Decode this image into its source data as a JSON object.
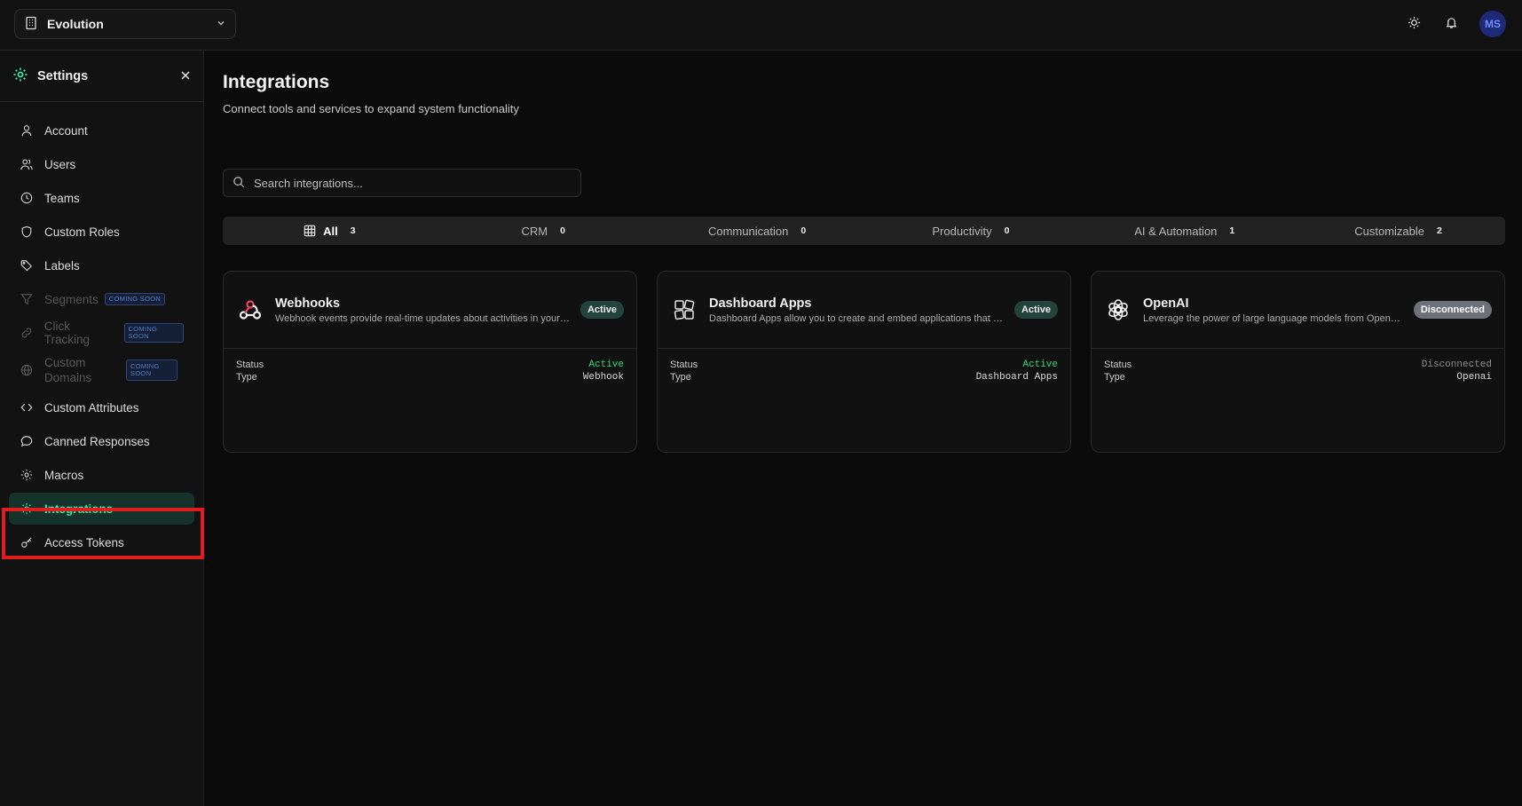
{
  "topbar": {
    "org_name": "Evolution",
    "avatar_initials": "MS"
  },
  "sidebar": {
    "title": "Settings",
    "coming_soon_label": "COMING SOON",
    "items": [
      {
        "label": "Account",
        "icon": "user-icon"
      },
      {
        "label": "Users",
        "icon": "users-icon"
      },
      {
        "label": "Teams",
        "icon": "clock-icon"
      },
      {
        "label": "Custom Roles",
        "icon": "shield-icon"
      },
      {
        "label": "Labels",
        "icon": "tag-icon"
      },
      {
        "label": "Segments",
        "icon": "filter-icon"
      },
      {
        "label": "Click Tracking",
        "icon": "link-icon"
      },
      {
        "label": "Custom Domains",
        "icon": "globe-icon"
      },
      {
        "label": "Custom Attributes",
        "icon": "code-icon"
      },
      {
        "label": "Canned Responses",
        "icon": "message-icon"
      },
      {
        "label": "Macros",
        "icon": "gear-icon"
      },
      {
        "label": "Integrations",
        "icon": "gear-icon"
      },
      {
        "label": "Access Tokens",
        "icon": "key-icon"
      }
    ]
  },
  "main": {
    "title": "Integrations",
    "subtitle": "Connect tools and services to expand system functionality",
    "search_placeholder": "Search integrations...",
    "filters": [
      {
        "label": "All",
        "count": "3"
      },
      {
        "label": "CRM",
        "count": "0"
      },
      {
        "label": "Communication",
        "count": "0"
      },
      {
        "label": "Productivity",
        "count": "0"
      },
      {
        "label": "AI & Automation",
        "count": "1"
      },
      {
        "label": "Customizable",
        "count": "2"
      }
    ],
    "status_label": "Status",
    "type_label": "Type",
    "cards": [
      {
        "name": "Webhooks",
        "description": "Webhook events provide real-time updates about activities in your Evolution account",
        "badge": "Active",
        "status": "Active",
        "type": "Webhook",
        "icon": "webhook-icon"
      },
      {
        "name": "Dashboard Apps",
        "description": "Dashboard Apps allow you to create and embed applications that display information",
        "badge": "Active",
        "status": "Active",
        "type": "Dashboard Apps",
        "icon": "dashboard-apps-icon"
      },
      {
        "name": "OpenAI",
        "description": "Leverage the power of large language models from OpenAI with features",
        "badge": "Disconnected",
        "status": "Disconnected",
        "type": "Openai",
        "icon": "openai-icon"
      }
    ]
  },
  "colors": {
    "accent": "#3ee6a1",
    "active_status": "#2bd97e",
    "highlight_box": "#e01e1e"
  }
}
